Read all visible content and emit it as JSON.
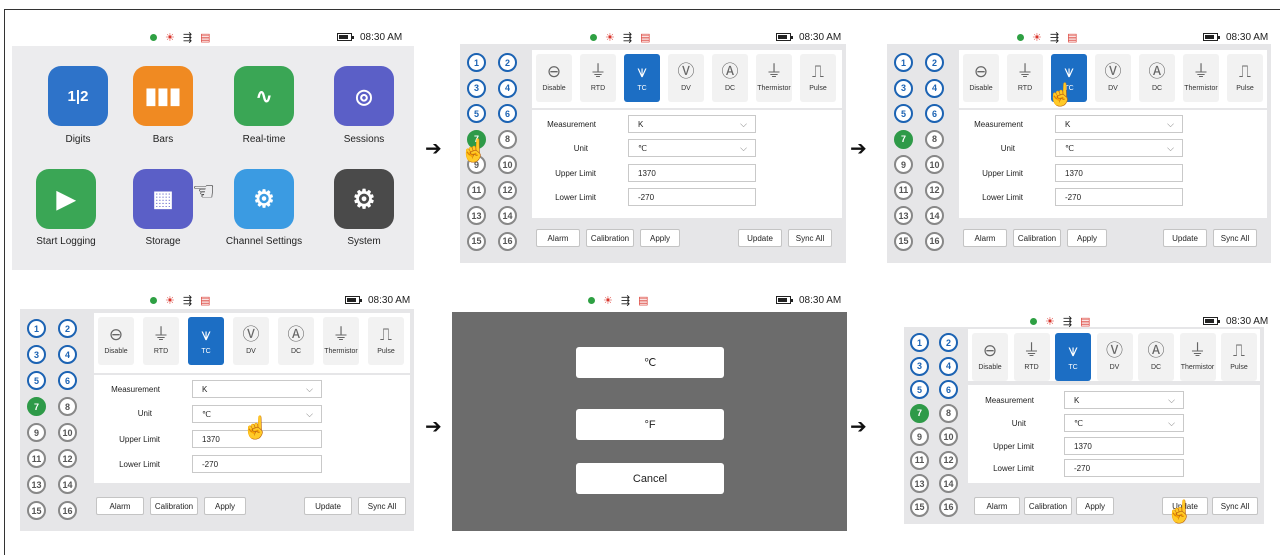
{
  "status": {
    "time": "08:30 AM",
    "dot_color": "#2ea043"
  },
  "home": {
    "apps": [
      {
        "label": "Digits",
        "icon": "digits-icon",
        "color": "#2e73c9"
      },
      {
        "label": "Bars",
        "icon": "bars-icon",
        "color": "#f08a22"
      },
      {
        "label": "Real-time",
        "icon": "realtime-icon",
        "color": "#3aa655"
      },
      {
        "label": "Sessions",
        "icon": "sessions-icon",
        "color": "#5b5fc7"
      },
      {
        "label": "Start Logging",
        "icon": "play-icon",
        "color": "#3aa655"
      },
      {
        "label": "Storage",
        "icon": "storage-icon",
        "color": "#5b5fc7"
      },
      {
        "label": "Channel Settings",
        "icon": "channel-settings-icon",
        "color": "#3b9be2"
      },
      {
        "label": "System",
        "icon": "system-gear-icon",
        "color": "#4a4a4a"
      }
    ]
  },
  "channels": [
    "1",
    "2",
    "3",
    "4",
    "5",
    "6",
    "7",
    "8",
    "9",
    "10",
    "11",
    "12",
    "13",
    "14",
    "15",
    "16"
  ],
  "sensors": [
    "Disable",
    "RTD",
    "TC",
    "DV",
    "DC",
    "Thermistor",
    "Pulse"
  ],
  "fields": {
    "measurement_label": "Measurement",
    "measurement_value": "K",
    "unit_label": "Unit",
    "unit_value": "℃",
    "upper_label": "Upper Limit",
    "upper_value": "1370",
    "lower_label": "Lower Limit",
    "lower_value": "-270"
  },
  "buttons": {
    "alarm": "Alarm",
    "calibration": "Calibration",
    "apply": "Apply",
    "update": "Update",
    "sync_all": "Sync All"
  },
  "dialog": {
    "option_c": "℃",
    "option_f": "°F",
    "cancel": "Cancel"
  }
}
